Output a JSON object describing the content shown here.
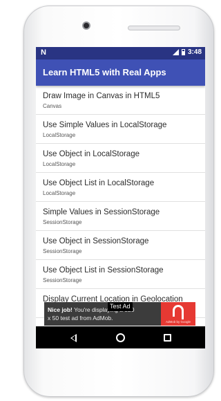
{
  "status_bar": {
    "notification_icon": "N",
    "time": "3:48",
    "icons": [
      "signal-icon",
      "battery-icon"
    ]
  },
  "app_bar": {
    "title": "Learn HTML5 with Real Apps"
  },
  "list": {
    "items": [
      {
        "title": "Draw Image in Canvas in HTML5",
        "subtitle": "Canvas"
      },
      {
        "title": "Use Simple Values in LocalStorage",
        "subtitle": "LocalStorage"
      },
      {
        "title": "Use Object in LocalStorage",
        "subtitle": "LocalStorage"
      },
      {
        "title": "Use Object List in LocalStorage",
        "subtitle": "LocalStorage"
      },
      {
        "title": "Simple Values in SessionStorage",
        "subtitle": "SessionStorage"
      },
      {
        "title": "Use Object in SessionStorage",
        "subtitle": "SessionStorage"
      },
      {
        "title": "Use Object List in SessionStorage",
        "subtitle": "SessionStorage"
      },
      {
        "title": "Display Current Location in Geolocation",
        "subtitle": ""
      }
    ]
  },
  "ad": {
    "label": "Test Ad",
    "headline": "Nice job!",
    "body_part1": "You're displaying a 320 x 50",
    "body_part2": "test ad from AdMob.",
    "icon_caption": "AdMob by Google",
    "icon": "admob-logo-icon"
  },
  "nav": {
    "icons": [
      "back-icon",
      "home-icon",
      "recents-icon"
    ]
  },
  "colors": {
    "status_bar": "#293483",
    "app_bar": "#3f51b5",
    "ad_background": "#3c3c3c",
    "ad_icon_background": "#e63933",
    "nav_bar": "#000000"
  }
}
